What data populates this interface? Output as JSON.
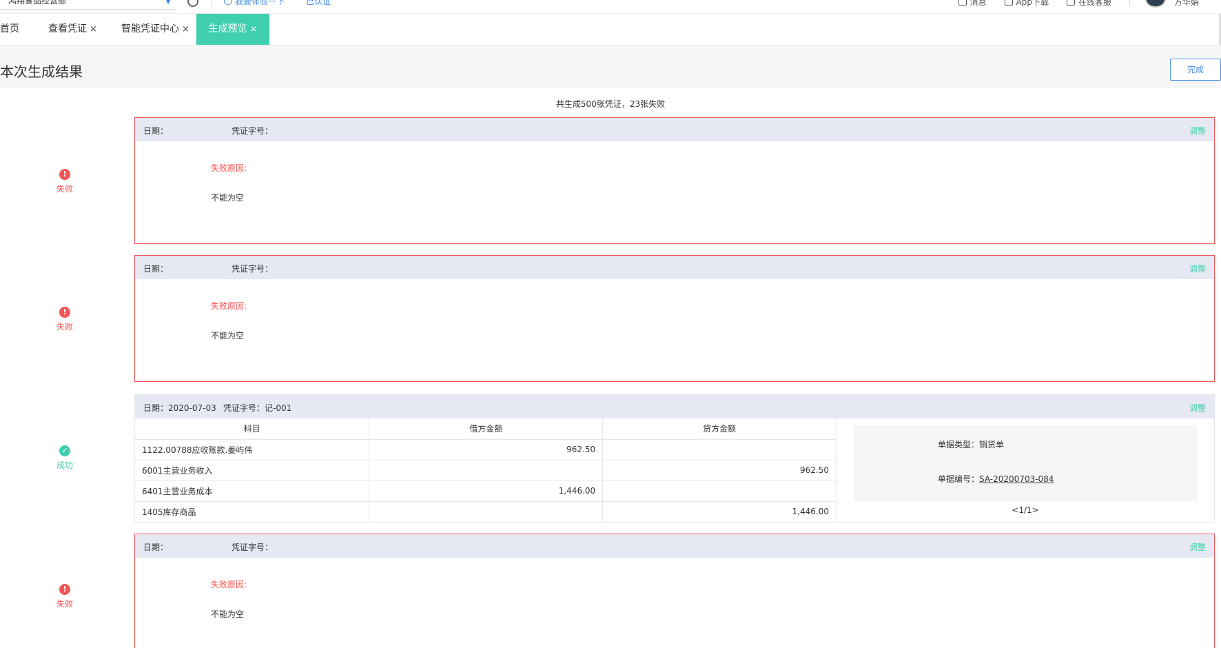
{
  "topbar": {
    "company": "鸿翔食品经营部",
    "try_link": "我要体验一下",
    "certified": "已认证",
    "messages": "消息",
    "app_download": "App下载",
    "online_service": "在线客服",
    "username": "方华娟"
  },
  "tabs": [
    {
      "label": "首页"
    },
    {
      "label": "查看凭证",
      "close": "×"
    },
    {
      "label": "智能凭证中心",
      "close": "×"
    },
    {
      "label": "生成预览",
      "close": "×",
      "active": true
    }
  ],
  "header": {
    "title": "本次生成结果",
    "done_label": "完成"
  },
  "summary": "共生成500张凭证，23张失败",
  "labels": {
    "date": "日期：",
    "voucher_no": "凭证字号：",
    "adjust": "调整",
    "fail_reason": "失败原因:",
    "status_fail": "失败",
    "status_ok": "成功",
    "fail_icon": "!",
    "ok_icon": "✓"
  },
  "vouchers": [
    {
      "status": "失败",
      "date": "",
      "voucher_no": "",
      "fail_reason": "不能为空"
    },
    {
      "status": "失败",
      "date": "",
      "voucher_no": "",
      "fail_reason": "不能为空"
    },
    {
      "status": "成功",
      "date": "2020-07-03",
      "voucher_no": "记-001",
      "columns": [
        "科目",
        "借方金额",
        "贷方金额"
      ],
      "rows": [
        {
          "account": "1122.00788应收账款.姜屿伟",
          "debit": "962.50",
          "credit": ""
        },
        {
          "account": "6001主营业务收入",
          "debit": "",
          "credit": "962.50"
        },
        {
          "account": "6401主营业务成本",
          "debit": "1,446.00",
          "credit": ""
        },
        {
          "account": "1405库存商品",
          "debit": "",
          "credit": "1,446.00"
        }
      ],
      "doc_type_label": "单据类型：",
      "doc_type": "销货单",
      "doc_no_label": "单据编号：",
      "doc_no": "SA-20200703-084",
      "pager": "<1/1>"
    },
    {
      "status": "失败",
      "date": "",
      "voucher_no": "",
      "fail_reason": "不能为空"
    }
  ],
  "colors": {
    "accent": "#3fcfae",
    "fail": "#f25555",
    "link": "#4a90e2",
    "card_header": "#e6e9f4"
  }
}
